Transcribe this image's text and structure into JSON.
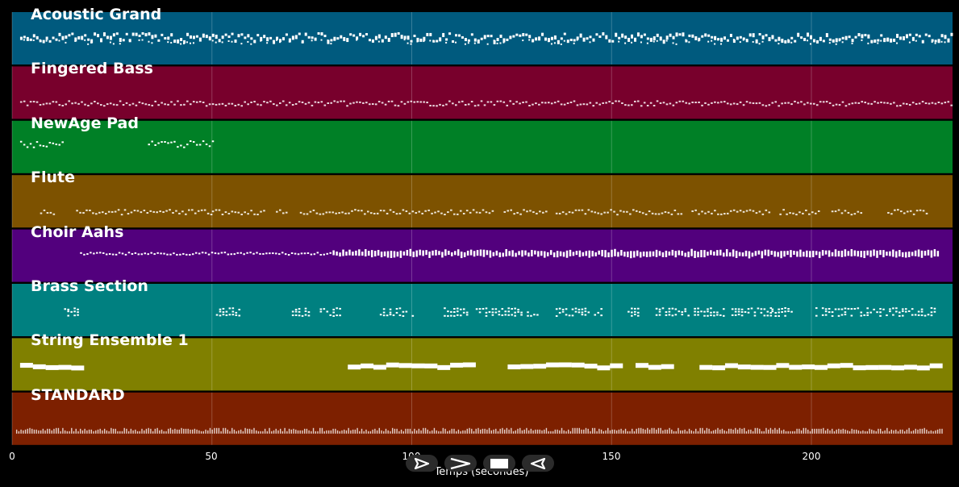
{
  "tracks": [
    {
      "name": "Acoustic Grand",
      "color": "#005a7e",
      "style": "dense"
    },
    {
      "name": "Fingered Bass",
      "color": "#78002c",
      "style": "thin"
    },
    {
      "name": "NewAge Pad",
      "color": "#008026",
      "style": "sparse"
    },
    {
      "name": "Flute",
      "color": "#7d5200",
      "style": "thin"
    },
    {
      "name": "Choir Aahs",
      "color": "#52007d",
      "style": "medium"
    },
    {
      "name": "Brass Section",
      "color": "#008080",
      "style": "clusters"
    },
    {
      "name": "String Ensemble 1",
      "color": "#808000",
      "style": "blocks"
    },
    {
      "name": "STANDARD",
      "color": "#7d2000",
      "style": "drums"
    }
  ],
  "timeline": {
    "ticks": [
      "0",
      "50",
      "100",
      "150",
      "200"
    ],
    "tick_values": [
      0,
      50,
      100,
      150,
      200
    ],
    "max_seconds": 235,
    "axis_label": "Temps (secondes)"
  },
  "controls": [
    {
      "name": "play-button",
      "icon": "play-icon"
    },
    {
      "name": "fast-forward-button",
      "icon": "fast-forward-icon"
    },
    {
      "name": "stop-button",
      "icon": "stop-icon"
    },
    {
      "name": "rewind-button",
      "icon": "rewind-icon"
    }
  ]
}
